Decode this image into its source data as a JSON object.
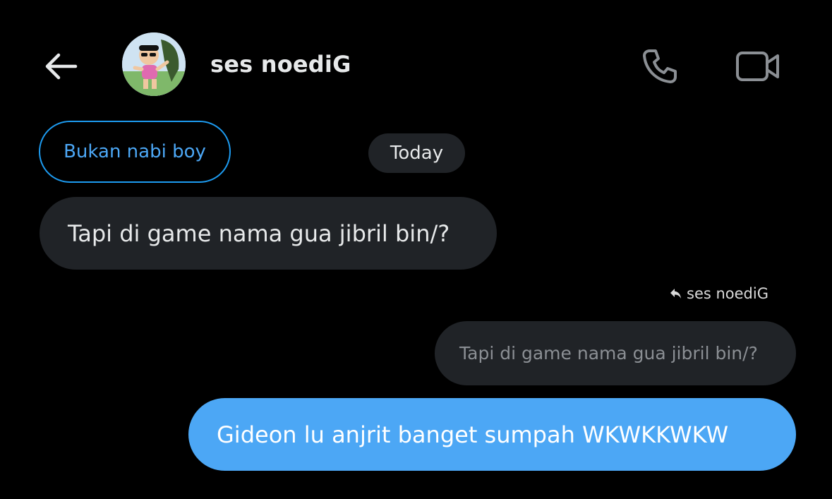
{
  "header": {
    "back_icon": "arrow-left-icon",
    "contact_name": "ses noediG",
    "call_icon": "phone-icon",
    "video_icon": "video-camera-icon"
  },
  "conversation": {
    "context_label": "Bukan nabi boy",
    "date_divider": "Today",
    "messages": [
      {
        "direction": "incoming",
        "text": "Tapi di game nama gua jibril bin/?"
      },
      {
        "direction": "outgoing",
        "reply_to_name": "ses noediG",
        "reply_icon": "reply-arrow-icon",
        "quoted_text": "Tapi di game nama gua jibril bin/?",
        "text": "Gideon lu anjrit banget sumpah WKWKKWKW"
      }
    ]
  },
  "colors": {
    "background": "#000000",
    "incoming_bubble": "#202327",
    "outgoing_bubble": "#4ca7f5",
    "accent": "#1d9bf0",
    "text_primary": "#e7e9ea",
    "text_muted": "#8b8f94"
  }
}
